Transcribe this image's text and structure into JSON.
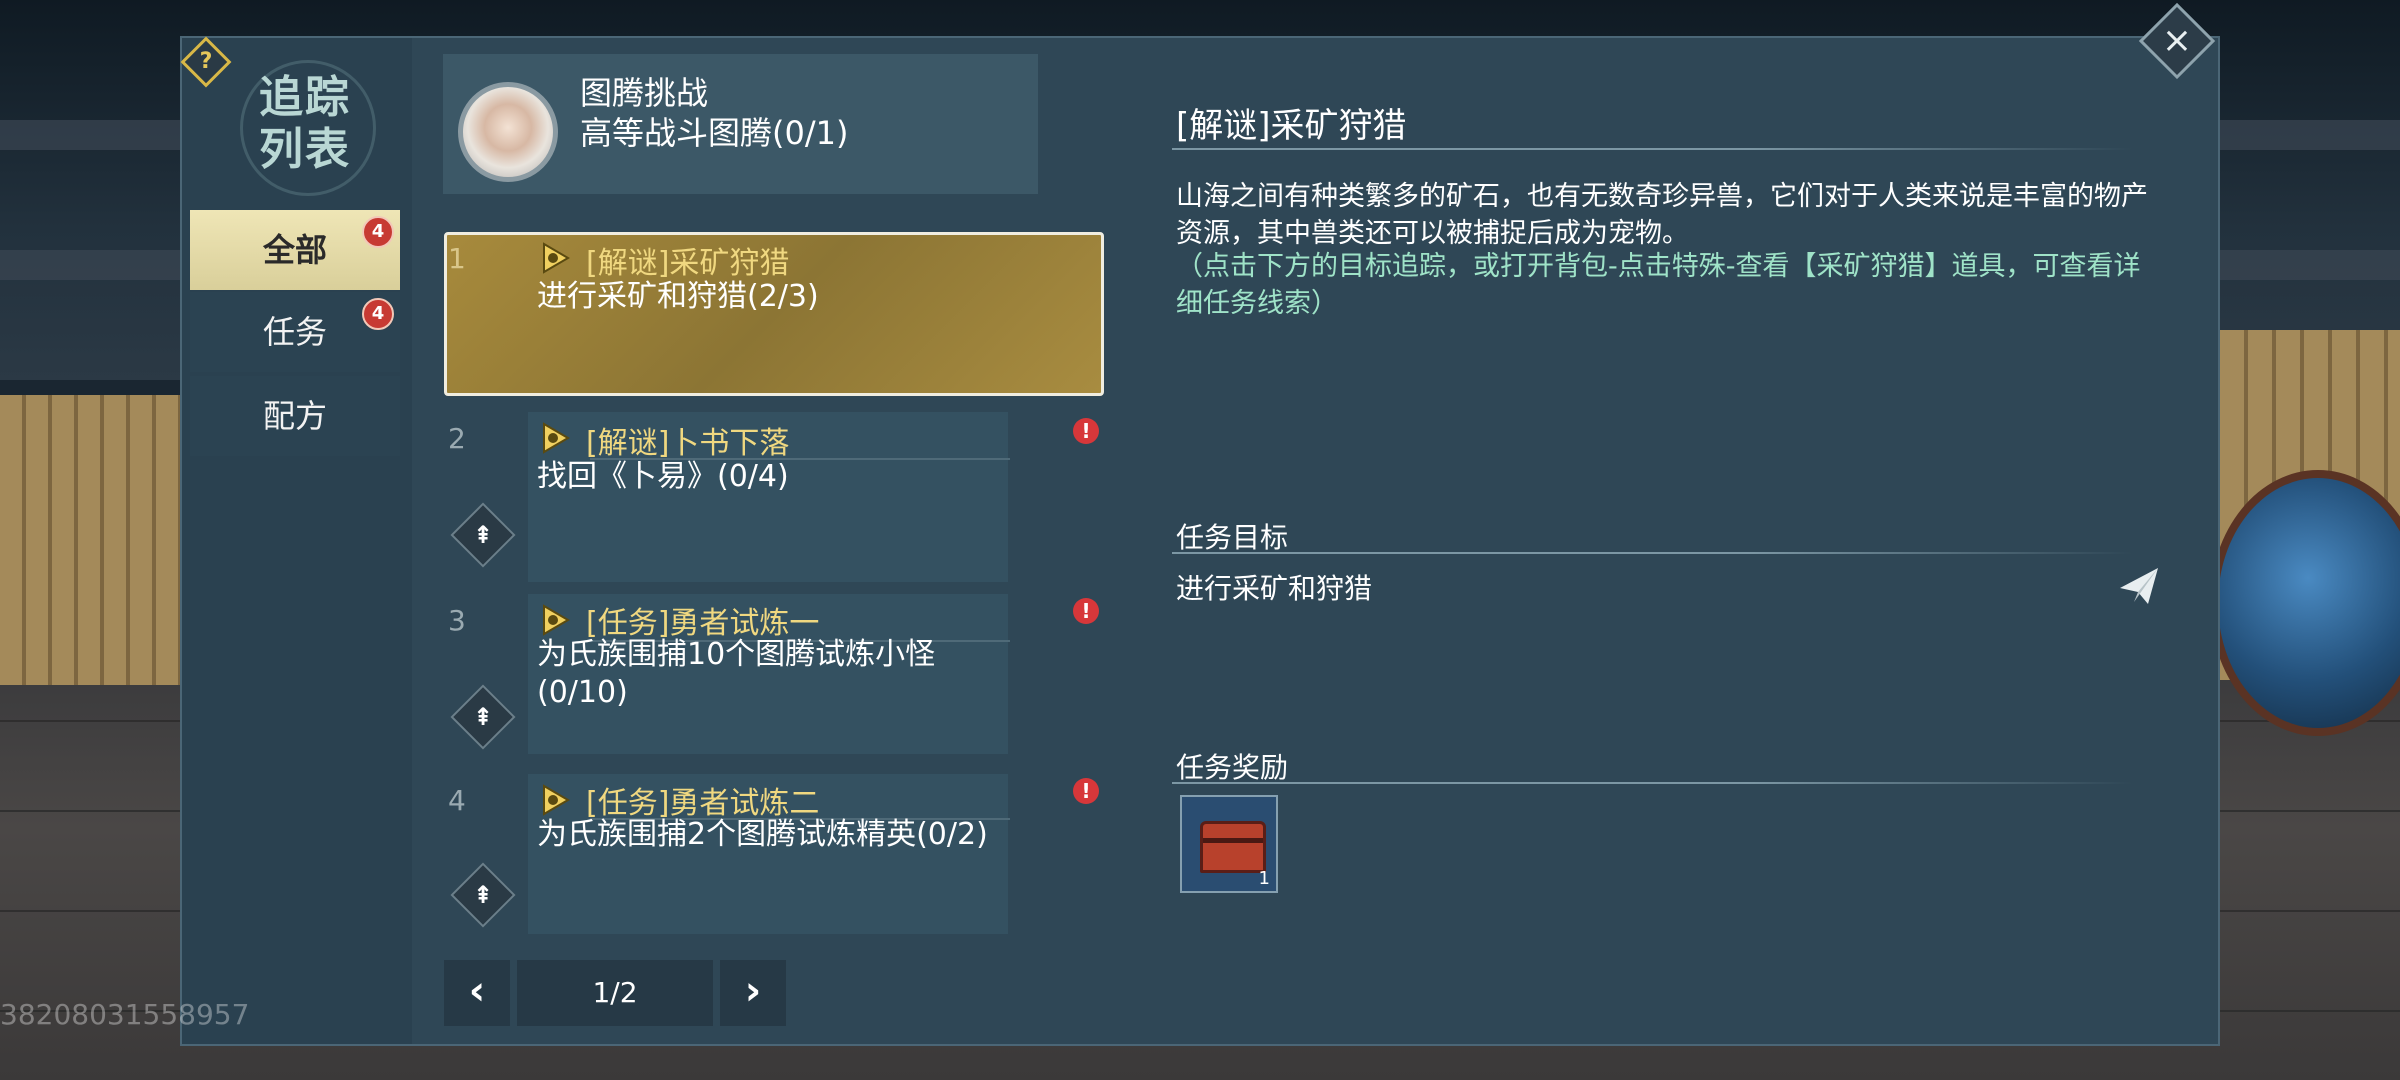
{
  "header": {
    "emblem_lines": [
      "追踪",
      "列表"
    ],
    "help_icon": "?",
    "close_icon": "×"
  },
  "categories": [
    {
      "label": "全部",
      "badge": "4",
      "active": true
    },
    {
      "label": "任务",
      "badge": "4",
      "active": false
    },
    {
      "label": "配方",
      "badge": "",
      "active": false
    }
  ],
  "pinned": {
    "title": "图腾挑战",
    "subtitle": "高等战斗图腾(0/1)"
  },
  "quests": [
    {
      "num": "1",
      "title": "[解谜]采矿狩猎",
      "desc": "进行采矿和狩猎(2/3)",
      "alert": "",
      "selected": true
    },
    {
      "num": "2",
      "title": "[解谜]卜书下落",
      "desc": "找回《卜易》(0/4)",
      "alert": "!",
      "selected": false
    },
    {
      "num": "3",
      "title": "[任务]勇者试炼一",
      "desc": "为氏族围捕10个图腾试炼小怪(0/10)",
      "alert": "!",
      "selected": false
    },
    {
      "num": "4",
      "title": "[任务]勇者试炼二",
      "desc": "为氏族围捕2个图腾试炼精英(0/2)",
      "alert": "!",
      "selected": false
    }
  ],
  "pin_icon_glyph": "⇞",
  "pager": {
    "prev": "‹",
    "label": "1/2",
    "next": "›"
  },
  "detail": {
    "title": "[解谜]采矿狩猎",
    "body": "山海之间有种类繁多的矿石，也有无数奇珍异兽，它们对于人类来说是丰富的物产资源，其中兽类还可以被捕捉后成为宠物。",
    "hint": "（点击下方的目标追踪，或打开背包-点击特殊-查看【采矿狩猎】道具，可查看详细任务线索）",
    "goal_section": "任务目标",
    "goal": "进行采矿和狩猎",
    "reward_section": "任务奖励",
    "reward_count": "1"
  },
  "uid": "38208031558957",
  "colors": {
    "accent_gold": "#f0d880",
    "hint_green": "#9fe3c8",
    "panel": "#2f4756",
    "badge_red": "#c73a33"
  }
}
